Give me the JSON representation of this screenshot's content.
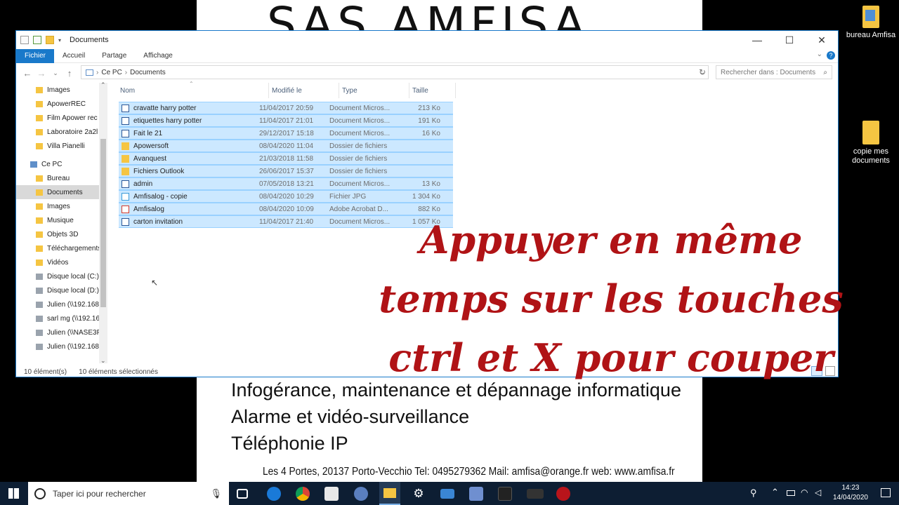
{
  "document": {
    "title": "SAS AMFISA",
    "lines": [
      "Infogérance, maintenance et dépannage informatique",
      "Alarme et vidéo-surveillance",
      "Téléphonie IP"
    ],
    "contact": "Les 4 Portes, 20137 Porto-Vecchio   Tel: 0495279362   Mail: amfisa@orange.fr   web: www.amfisa.fr"
  },
  "desktop_icons": [
    "bureau Amfisa",
    "copie mes documents"
  ],
  "explorer": {
    "title": "Documents",
    "ribbon_tabs": [
      "Fichier",
      "Accueil",
      "Partage",
      "Affichage"
    ],
    "breadcrumb": [
      "Ce PC",
      "Documents"
    ],
    "search_placeholder": "Rechercher dans : Documents",
    "sidebar": [
      "Images",
      "ApowerREC",
      "Film Apower rec",
      "Laboratoire 2a2l",
      "Villa Pianelli",
      "Ce PC",
      "Bureau",
      "Documents",
      "Images",
      "Musique",
      "Objets 3D",
      "Téléchargements",
      "Vidéos",
      "Disque local (C:)",
      "Disque local (D:)",
      "Julien (\\\\192.168",
      "sarl mg (\\\\192.16",
      "Julien (\\\\NASE3F",
      "Julien (\\\\192.168"
    ],
    "columns": [
      "Nom",
      "Modifié le",
      "Type",
      "Taille"
    ],
    "files": [
      {
        "name": "cravatte harry potter",
        "date": "11/04/2017 20:59",
        "type": "Document Micros...",
        "size": "213 Ko",
        "kind": "doc"
      },
      {
        "name": "etiquettes harry potter",
        "date": "11/04/2017 21:01",
        "type": "Document Micros...",
        "size": "191 Ko",
        "kind": "doc"
      },
      {
        "name": "Fait le 21",
        "date": "29/12/2017 15:18",
        "type": "Document Micros...",
        "size": "16 Ko",
        "kind": "doc"
      },
      {
        "name": "Apowersoft",
        "date": "08/04/2020 11:04",
        "type": "Dossier de fichiers",
        "size": "",
        "kind": "folder"
      },
      {
        "name": "Avanquest",
        "date": "21/03/2018 11:58",
        "type": "Dossier de fichiers",
        "size": "",
        "kind": "folder"
      },
      {
        "name": "Fichiers Outlook",
        "date": "26/06/2017 15:37",
        "type": "Dossier de fichiers",
        "size": "",
        "kind": "folder"
      },
      {
        "name": "admin",
        "date": "07/05/2018 13:21",
        "type": "Document Micros...",
        "size": "13 Ko",
        "kind": "doc"
      },
      {
        "name": "Amfisalog - copie",
        "date": "08/04/2020 10:29",
        "type": "Fichier JPG",
        "size": "1 304 Ko",
        "kind": "jpg"
      },
      {
        "name": "Amfisalog",
        "date": "08/04/2020 10:09",
        "type": "Adobe Acrobat D...",
        "size": "882 Ko",
        "kind": "pdf"
      },
      {
        "name": "carton invitation",
        "date": "11/04/2017 21:40",
        "type": "Document Micros...",
        "size": "1 057 Ko",
        "kind": "doc"
      }
    ],
    "status_count": "10 élément(s)",
    "status_selected": "10 éléments sélectionnés"
  },
  "overlay_text": "Appuyer en même temps sur les touches ctrl et X pour couper",
  "taskbar": {
    "search_placeholder": "Taper ici pour rechercher",
    "time": "14:23",
    "date": "14/04/2020"
  },
  "colors": {
    "accent": "#1979ca",
    "selection": "#cce8ff",
    "overlay": "#b01316",
    "taskbar": "#0d1e33",
    "folder": "#f5c542"
  }
}
